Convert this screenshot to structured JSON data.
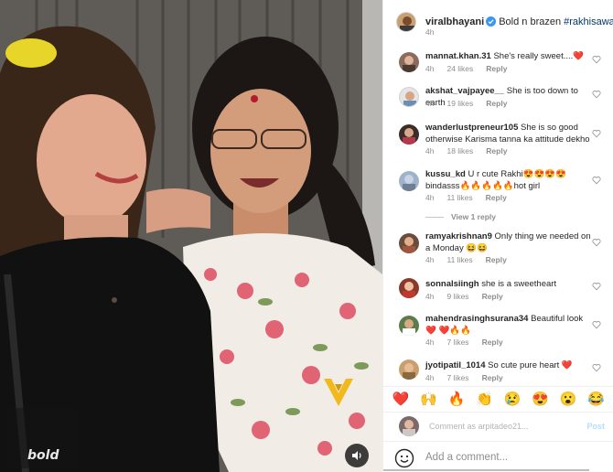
{
  "media": {
    "watermark_label": "bold",
    "brand_logo": "v-logo-icon",
    "sound_icon": "speaker-icon"
  },
  "post": {
    "username": "viralbhayani",
    "caption": "Bold n brazen ",
    "hashtag": "#rakhisawant",
    "time": "4h"
  },
  "comments": [
    {
      "user": "mannat.khan.31",
      "text": "She's really sweet....❤️",
      "time": "4h",
      "likes": "24 likes",
      "reply": "Reply"
    },
    {
      "user": "akshat_vajpayee__",
      "text": "She is too down to earth",
      "time": "4h",
      "likes": "19 likes",
      "reply": "Reply"
    },
    {
      "user": "wanderlustpreneur105",
      "text": "She is so good otherwise Karisma tanna ka attitude dekho",
      "time": "4h",
      "likes": "18 likes",
      "reply": "Reply"
    },
    {
      "user": "kussu_kd",
      "text": "U r cute Rakhi😍😍😍😍 bindasss🔥🔥🔥🔥🔥hot girl",
      "time": "4h",
      "likes": "11 likes",
      "reply": "Reply",
      "view_replies": "View 1 reply"
    },
    {
      "user": "ramyakrishnan9",
      "text": "Only thing we needed on a Monday 😆😆",
      "time": "4h",
      "likes": "11 likes",
      "reply": "Reply"
    },
    {
      "user": "sonnalsiingh",
      "text": "she is a sweetheart",
      "time": "4h",
      "likes": "9 likes",
      "reply": "Reply"
    },
    {
      "user": "mahendrasinghsurana34",
      "text": "Beautiful look ❤️ ❤️🔥🔥",
      "time": "4h",
      "likes": "7 likes",
      "reply": "Reply"
    },
    {
      "user": "jyotipatil_1014",
      "text": "So cute pure heart ❤️",
      "time": "4h",
      "likes": "7 likes",
      "reply": "Reply"
    }
  ],
  "reactions": [
    "❤️",
    "🙌",
    "🔥",
    "👏",
    "😢",
    "😍",
    "😮",
    "😂"
  ],
  "quick_comment": {
    "placeholder": "Comment as arpitadeo21...",
    "post_label": "Post"
  },
  "add_comment": {
    "placeholder": "Add a comment..."
  },
  "colors": {
    "link": "#00376b",
    "verified": "#3897f0",
    "muted": "#8e8e8e",
    "heart": "#ed4956"
  }
}
